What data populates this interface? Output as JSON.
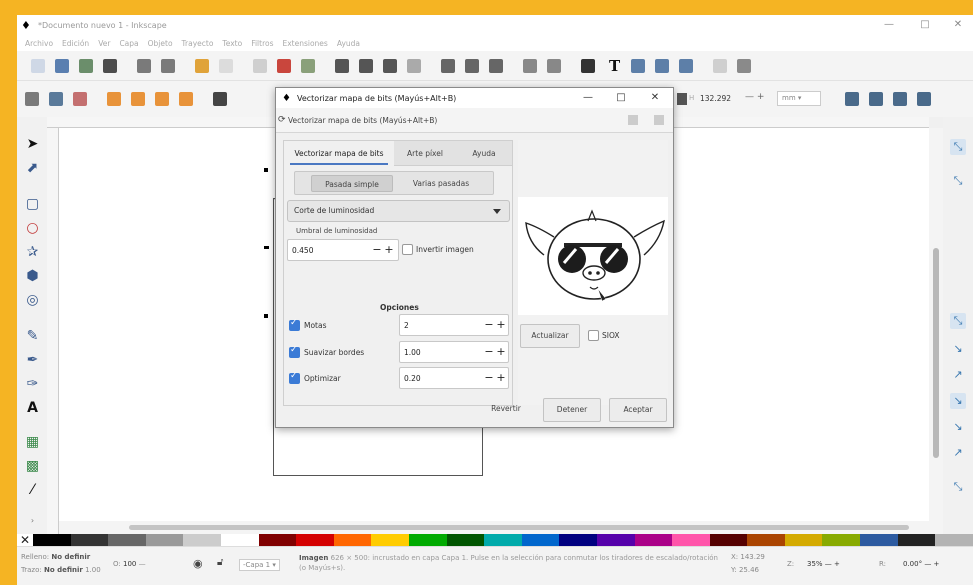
{
  "window": {
    "title": "*Documento nuevo 1 - Inkscape",
    "controls": {
      "minimize": "—",
      "maximize": "□",
      "close": "✕"
    }
  },
  "menu": [
    "Archivo",
    "Edición",
    "Ver",
    "Capa",
    "Objeto",
    "Trayecto",
    "Texto",
    "Filtros",
    "Extensiones",
    "Ayuda"
  ],
  "toolbar": {
    "text_tool_glyph": "T",
    "coord_value": "132.292",
    "unit": "mm"
  },
  "dialog": {
    "title": "Vectorizar mapa de bits (Mayús+Alt+B)",
    "subtitle": "Vectorizar mapa de bits (Mayús+Alt+B)",
    "controls": {
      "minimize": "—",
      "maximize": "□",
      "close": "✕"
    },
    "tabs": [
      {
        "label": "Vectorizar mapa de bits",
        "active": true
      },
      {
        "label": "Arte píxel",
        "active": false
      },
      {
        "label": "Ayuda",
        "active": false
      }
    ],
    "modes": [
      {
        "label": "Pasada simple",
        "active": true
      },
      {
        "label": "Varias pasadas",
        "active": false
      }
    ],
    "detection_mode": "Corte de luminosidad",
    "threshold_label": "Umbral de luminosidad",
    "threshold_value": "0.450",
    "invert_label": "Invertir imagen",
    "invert_checked": false,
    "options_label": "Opciones",
    "options": [
      {
        "label": "Motas",
        "value": "2",
        "checked": true
      },
      {
        "label": "Suavizar bordes",
        "value": "1.00",
        "checked": true
      },
      {
        "label": "Optimizar",
        "value": "0.20",
        "checked": true
      }
    ],
    "update_button": "Actualizar",
    "siox_label": "SIOX",
    "siox_checked": false,
    "buttons": {
      "revert": "Revertir",
      "stop": "Detener",
      "accept": "Aceptar"
    }
  },
  "statusbar": {
    "fill_label": "Relleno:",
    "fill_value": "No definir",
    "stroke_label": "Trazo:",
    "stroke_value": "No definir",
    "stroke_width": "1.00",
    "opacity_label": "O:",
    "opacity_value": "100",
    "layer": "-Capa 1",
    "message_bold": "Imagen",
    "message": "626 × 500: incrustado en capa Capa 1. Pulse en la selección para conmutar los tiradores de escalado/rotación (o Mayús+s).",
    "x_label": "X:",
    "x_value": "143.29",
    "y_label": "Y:",
    "y_value": "25.46",
    "z_label": "Z:",
    "zoom": "35%",
    "r_label": "R:",
    "rotation": "0.00°"
  },
  "colors": {
    "frame": "#f5b423",
    "accent": "#3b7bd6"
  }
}
